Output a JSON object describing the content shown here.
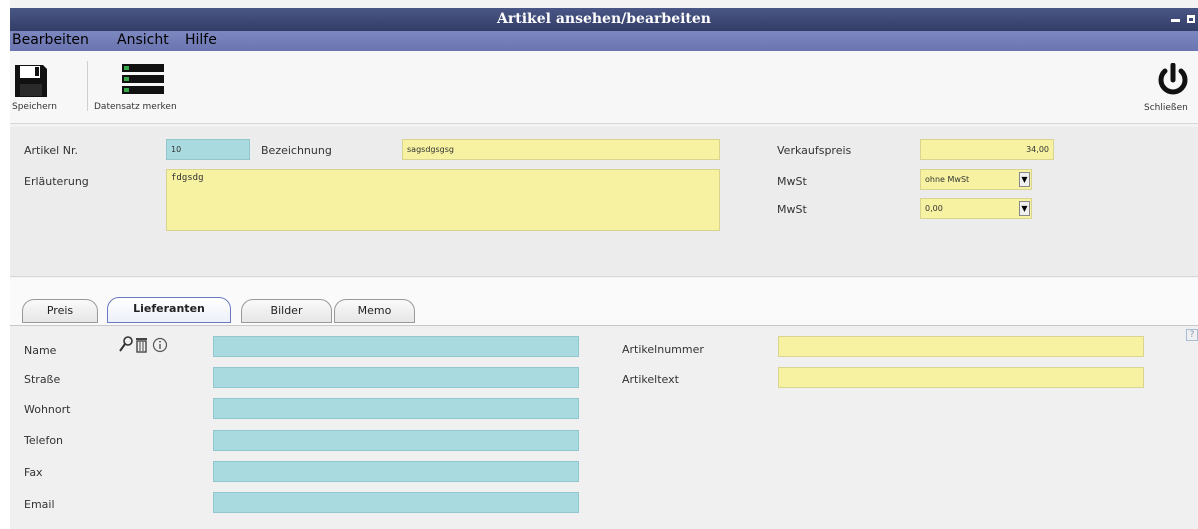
{
  "window": {
    "title": "Artikel ansehen/bearbeiten",
    "controls": {
      "minimize_icon": "minimize-icon",
      "maximize_icon": "maximize-icon",
      "close_label": "x"
    }
  },
  "menu": {
    "items": [
      "Bearbeiten",
      "Ansicht",
      "Hilfe"
    ]
  },
  "toolbar": {
    "save_label": "Speichern",
    "bookmark_label": "Datensatz merken",
    "close_label": "Schließen"
  },
  "form": {
    "artikel_nr_label": "Artikel Nr.",
    "artikel_nr_value": "10",
    "bezeichnung_label": "Bezeichnung",
    "bezeichnung_value": "sagsdgsgsg",
    "erlaeuterung_label": "Erläuterung",
    "erlaeuterung_value": "fdgsdg",
    "verkaufspreis_label": "Verkaufspreis",
    "verkaufspreis_value": "34,00",
    "mwst_label_1": "MwSt",
    "mwst_value_1": "ohne MwSt",
    "mwst_label_2": "MwSt",
    "mwst_value_2": "0,00"
  },
  "tabs": [
    {
      "label": "Preis",
      "active": false
    },
    {
      "label": "Lieferanten",
      "active": true
    },
    {
      "label": "Bilder",
      "active": false
    },
    {
      "label": "Memo",
      "active": false
    }
  ],
  "lieferanten": {
    "name_label": "Name",
    "strasse_label": "Straße",
    "wohnort_label": "Wohnort",
    "telefon_label": "Telefon",
    "fax_label": "Fax",
    "email_label": "Email",
    "artikelnummer_label": "Artikelnummer",
    "artikeltext_label": "Artikeltext",
    "help_label": "?"
  },
  "colors": {
    "titlebar": "#3a4576",
    "menubar": "#737eb9",
    "field_yellow": "#f6f2a2",
    "field_cyan": "#a8dadf"
  }
}
